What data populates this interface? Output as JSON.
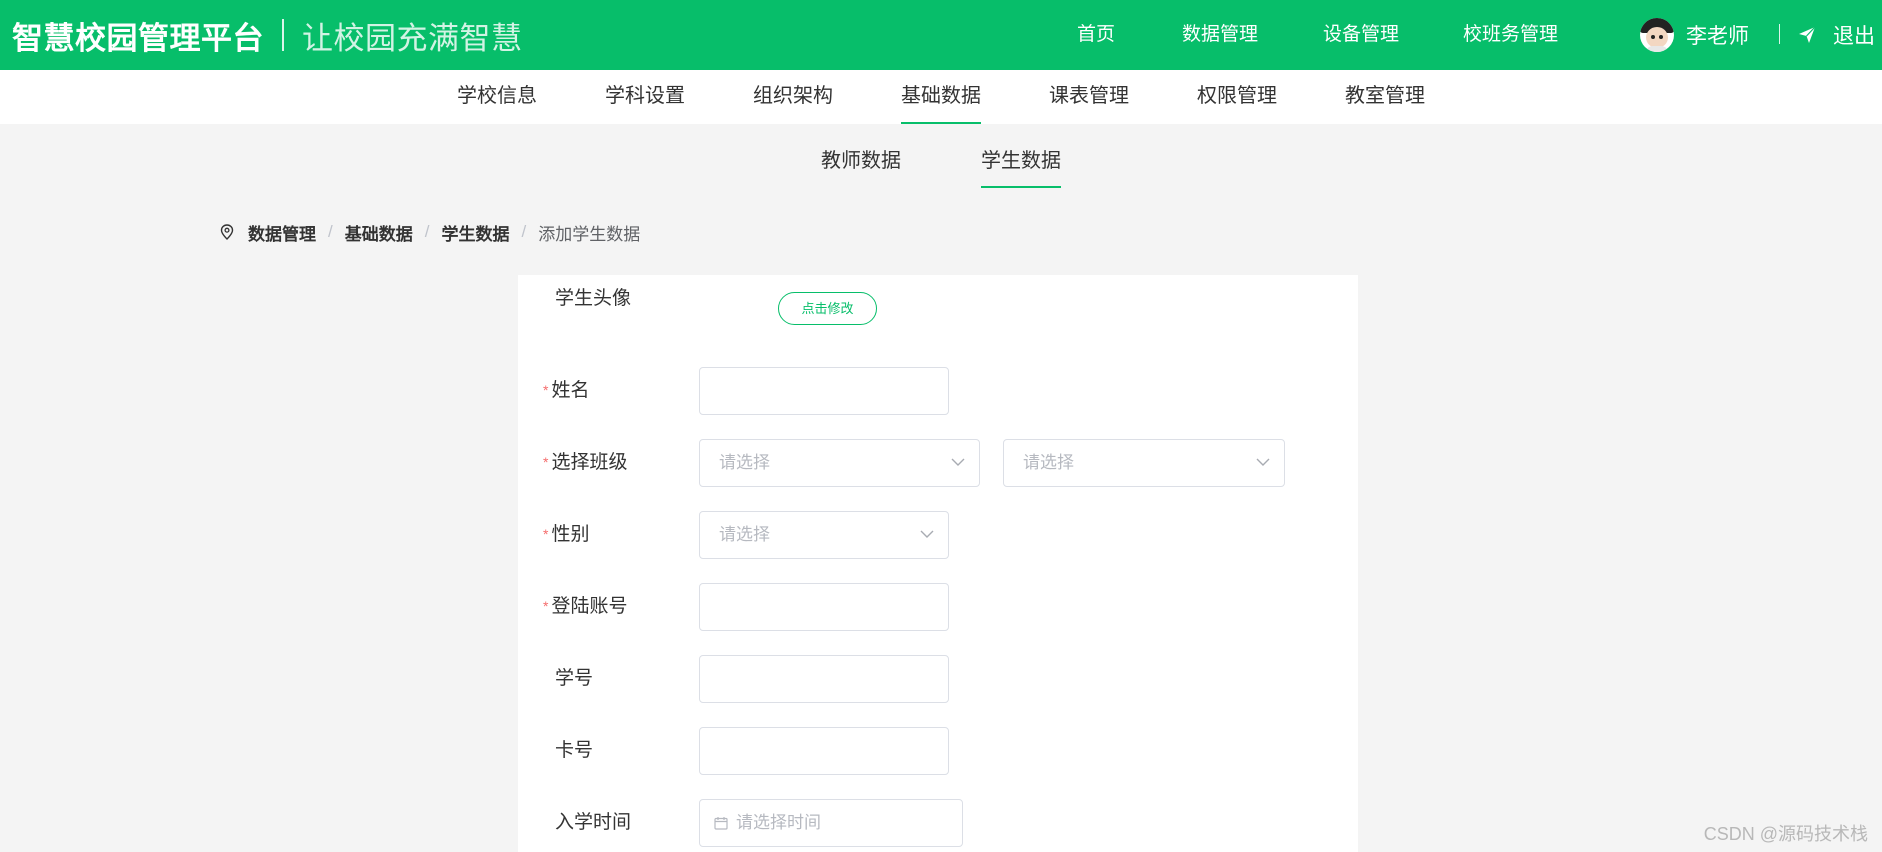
{
  "header": {
    "title": "智慧校园管理平台",
    "slogan": "让校园充满智慧",
    "nav": [
      "首页",
      "数据管理",
      "设备管理",
      "校班务管理"
    ],
    "user_name": "李老师",
    "logout_label": "退出"
  },
  "subnav": {
    "items": [
      "学校信息",
      "学科设置",
      "组织架构",
      "基础数据",
      "课表管理",
      "权限管理",
      "教室管理"
    ],
    "active": "基础数据"
  },
  "tabs": {
    "items": [
      "教师数据",
      "学生数据"
    ],
    "active": "学生数据"
  },
  "breadcrumb": {
    "items": [
      "数据管理",
      "基础数据",
      "学生数据"
    ],
    "current": "添加学生数据",
    "separator": "/"
  },
  "form": {
    "avatar_label": "学生头像",
    "avatar_button": "点击修改",
    "required_mark": "*",
    "name_label": "姓名",
    "name_value": "",
    "class_label": "选择班级",
    "class_grade_placeholder": "请选择",
    "class_class_placeholder": "请选择",
    "gender_label": "性别",
    "gender_placeholder": "请选择",
    "account_label": "登陆账号",
    "account_value": "",
    "student_no_label": "学号",
    "student_no_value": "",
    "card_no_label": "卡号",
    "card_no_value": "",
    "enroll_label": "入学时间",
    "enroll_placeholder": "请选择时间"
  },
  "watermark": "CSDN @源码技术栈",
  "colors": {
    "brand": "#07be6a",
    "required": "#f56c6c",
    "placeholder": "#b6b9c0",
    "border": "#dcdfe6",
    "background": "#f4f4f4"
  },
  "icons": {
    "avatar": "teacher-avatar",
    "logout": "paper-plane-icon",
    "breadcrumb": "location-pin-icon",
    "select": "chevron-down-icon",
    "date": "calendar-icon"
  }
}
